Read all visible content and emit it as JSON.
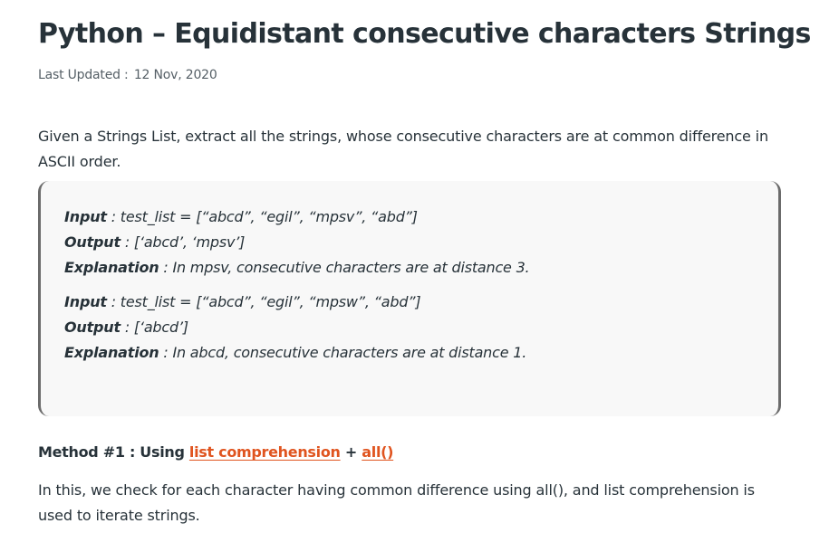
{
  "article": {
    "title": "Python – Equidistant consecutive characters Strings",
    "updated_label": "Last Updated :",
    "updated_date": "12 Nov, 2020",
    "intro": "Given a Strings List, extract all the strings, whose consecutive characters are at common difference in ASCII order."
  },
  "examples": [
    {
      "input_key": "Input",
      "input_val": " : test_list = [“abcd”, “egil”, “mpsv”, “abd”]",
      "output_key": "Output",
      "output_val": " : [‘abcd’, ‘mpsv’]",
      "explanation_key": "Explanation",
      "explanation_val": " : In mpsv, consecutive characters are at distance 3."
    },
    {
      "input_key": "Input",
      "input_val": " : test_list = [“abcd”, “egil”, “mpsw”, “abd”]",
      "output_key": "Output",
      "output_val": " : [‘abcd’]",
      "explanation_key": "Explanation",
      "explanation_val": " : In abcd, consecutive characters are at distance 1."
    }
  ],
  "method": {
    "prefix": "Method #1 : Using ",
    "link1": "list comprehension",
    "joiner": " + ",
    "link2": "all()"
  },
  "description": "In this, we check for each character having common difference using all(), and list comprehension is used to iterate strings.",
  "colors": {
    "text": "#273239",
    "link": "#e0541f",
    "box_bg": "#f8f8f8",
    "box_border": "#6b6b6b"
  }
}
